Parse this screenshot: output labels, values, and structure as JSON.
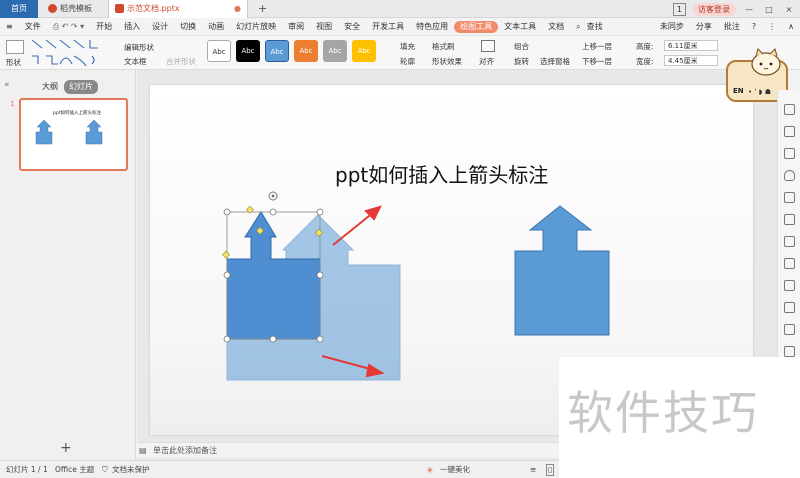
{
  "titlebar": {
    "home_tab": "首页",
    "template_tab": "稻壳模板",
    "doc_tab": "示范文档.pptx",
    "add_tab": "+",
    "page_badge": "1",
    "login": "访客登录",
    "min": "—",
    "max": "□",
    "close": "×"
  },
  "menubar": {
    "file": "文件",
    "items": [
      "开始",
      "插入",
      "设计",
      "切换",
      "动画",
      "幻灯片放映",
      "审阅",
      "视图",
      "安全",
      "开发工具",
      "特色应用",
      "绘图工具",
      "文本工具",
      "文档"
    ],
    "active_index": 11,
    "search": "查找",
    "sync": "未同步",
    "share": "分享",
    "comment": "批注"
  },
  "ribbon": {
    "shapes_label": "形状",
    "edit_shape": "编辑形状",
    "textbox": "文本框",
    "merge_shape": "合并形状",
    "styles": [
      "Abc",
      "Abc",
      "Abc",
      "Abc",
      "Abc",
      "Abc"
    ],
    "style_colors": [
      "#ffffff",
      "#000000",
      "#5b9bd5",
      "#ed7d31",
      "#a5a5a5",
      "#ffc000"
    ],
    "fill": "填充",
    "format_brush": "格式刷",
    "outline": "轮廓",
    "shape_effect": "形状效果",
    "align": "对齐",
    "group": "组合",
    "rotate": "旋转",
    "select_pane": "选择窗格",
    "bring_forward": "上移一层",
    "send_backward": "下移一层",
    "height_label": "高度:",
    "height_value": "6.11厘米",
    "width_label": "宽度:",
    "width_value": "4.45厘米"
  },
  "leftpanel": {
    "outline_tab": "大纲",
    "slides_tab": "幻灯片",
    "slide_number": "1",
    "thumb_title": "ppt如何插入上箭头标注",
    "add_slide": "+"
  },
  "slide": {
    "title": "ppt如何插入上箭头标注"
  },
  "notes": {
    "placeholder": "单击此处添加备注"
  },
  "status": {
    "slide_info": "幻灯片 1 / 1",
    "theme": "Office 主题",
    "protect": "文档未保护",
    "beautify": "一键美化"
  },
  "mascot": {
    "text": "EN"
  },
  "watermark": {
    "text": "软件技巧"
  }
}
